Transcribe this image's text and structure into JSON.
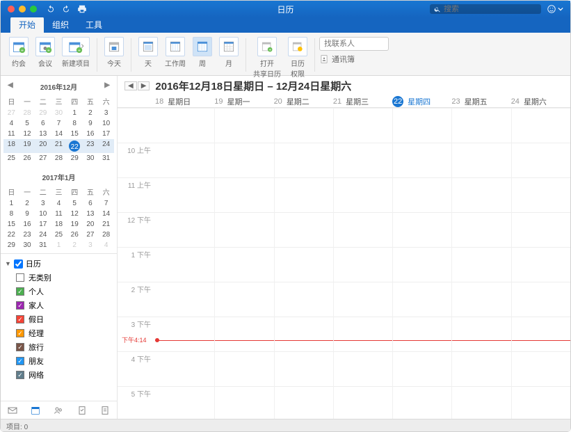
{
  "titlebar": {
    "title": "日历",
    "search_placeholder": "搜索"
  },
  "tabs": [
    "开始",
    "组织",
    "工具"
  ],
  "ribbon": {
    "appointment": "约会",
    "meeting": "会议",
    "new_item": "新建项目",
    "today": "今天",
    "day": "天",
    "workweek": "工作周",
    "week": "周",
    "month": "月",
    "open_shared": "打开\n共享日历",
    "perm": "日历\n权限",
    "addressbook": "通讯簿",
    "find_contact_placeholder": "找联系人"
  },
  "minical1": {
    "title": "2016年12月",
    "headers": [
      "日",
      "一",
      "二",
      "三",
      "四",
      "五",
      "六"
    ],
    "lead": [
      27,
      28,
      29,
      30
    ],
    "days": 31,
    "today": 22,
    "weekstart": 18
  },
  "minical2": {
    "title": "2017年1月",
    "headers": [
      "日",
      "一",
      "二",
      "三",
      "四",
      "五",
      "六"
    ],
    "days": 31,
    "trail": [
      1,
      2,
      3,
      4
    ]
  },
  "folders": {
    "root": "日历",
    "items": [
      {
        "label": "无类别",
        "color": "#ffffff"
      },
      {
        "label": "个人",
        "color": "#4caf50"
      },
      {
        "label": "家人",
        "color": "#9c27b0"
      },
      {
        "label": "假日",
        "color": "#f44336"
      },
      {
        "label": "经理",
        "color": "#ff9800"
      },
      {
        "label": "旅行",
        "color": "#795548"
      },
      {
        "label": "朋友",
        "color": "#2196f3"
      },
      {
        "label": "网络",
        "color": "#607d8b"
      }
    ]
  },
  "content": {
    "range_title": "2016年12月18日星期日 – 12月24日星期六",
    "days": [
      {
        "num": "18",
        "name": "星期日"
      },
      {
        "num": "19",
        "name": "星期一"
      },
      {
        "num": "20",
        "name": "星期二"
      },
      {
        "num": "21",
        "name": "星期三"
      },
      {
        "num": "22",
        "name": "星期四",
        "today": true
      },
      {
        "num": "23",
        "name": "星期五"
      },
      {
        "num": "24",
        "name": "星期六"
      }
    ],
    "hours": [
      "",
      "10 上午",
      "11 上午",
      "12 下午",
      "1 下午",
      "2 下午",
      "3 下午",
      "4 下午",
      "5 下午"
    ],
    "now_label": "下午4:14"
  },
  "status": {
    "items_label": "项目:",
    "items_count": "0"
  }
}
